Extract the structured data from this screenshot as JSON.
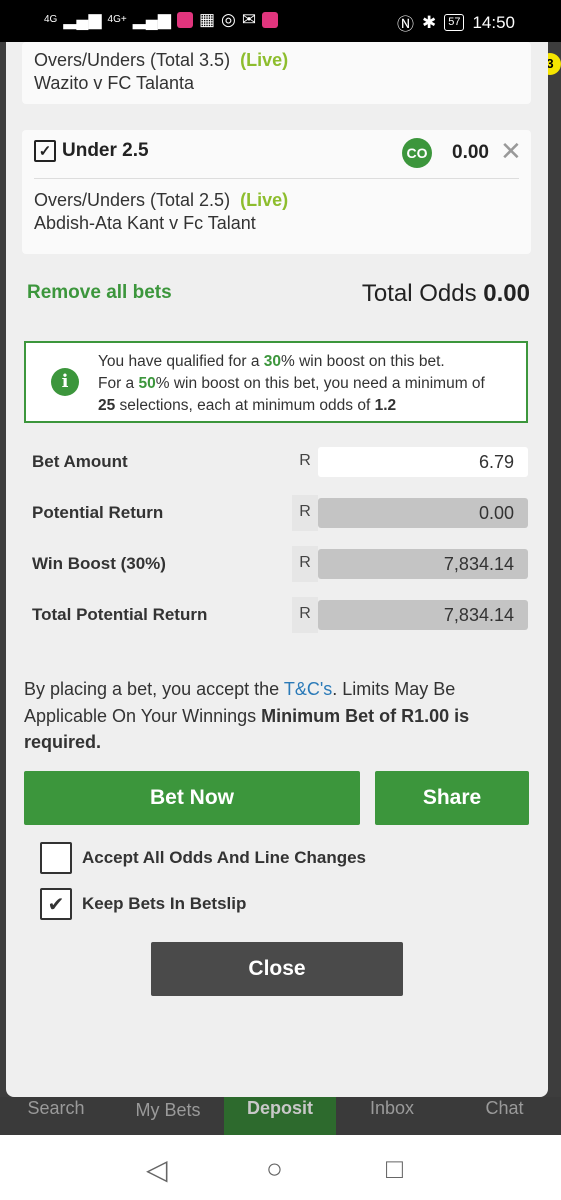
{
  "status_bar": {
    "net1": "4G",
    "net2": "4G+",
    "battery": "57",
    "time": "14:50"
  },
  "background": {
    "badge": "3"
  },
  "bets": [
    {
      "market": "Overs/Unders (Total 3.5)",
      "live": "(Live)",
      "match": "Wazito v FC Talanta"
    },
    {
      "selection": "Under 2.5",
      "co_label": "CO",
      "odds": "0.00",
      "market": "Overs/Unders (Total 2.5)",
      "live": "(Live)",
      "match": "Abdish-Ata Kant v Fc Talant"
    }
  ],
  "remove_all": "Remove all bets",
  "total_odds": {
    "label": "Total Odds",
    "value": "0.00"
  },
  "boost": {
    "line1_pre": "You have qualified for a ",
    "line1_pct": "30",
    "line1_post": "% win boost on this bet.",
    "line2_pre": "For a ",
    "line2_pct": "50",
    "line2_post": "% win boost on this bet, you need a minimum of",
    "line3_count": "25",
    "line3_mid": " selections, each at minimum odds of ",
    "line3_odds": "1.2"
  },
  "amounts": [
    {
      "label": "Bet Amount",
      "currency": "R",
      "value": "6.79"
    },
    {
      "label": "Potential Return",
      "currency": "R",
      "value": "0.00"
    },
    {
      "label": "Win Boost (30%)",
      "currency": "R",
      "value": "7,834.14"
    },
    {
      "label": "Total Potential Return",
      "currency": "R",
      "value": "7,834.14"
    }
  ],
  "terms": {
    "pre": "By placing a bet, you accept the ",
    "link": "T&C's",
    "mid": ". Limits May Be Applicable On Your Winnings ",
    "bold": "Minimum Bet of R1.00 is required."
  },
  "buttons": {
    "bet_now": "Bet Now",
    "share": "Share",
    "close": "Close"
  },
  "options": {
    "accept_changes": "Accept All Odds And Line Changes",
    "keep_bets": "Keep Bets In Betslip"
  },
  "tabs": [
    "Search",
    "My Bets",
    "Deposit",
    "Inbox",
    "Chat"
  ]
}
